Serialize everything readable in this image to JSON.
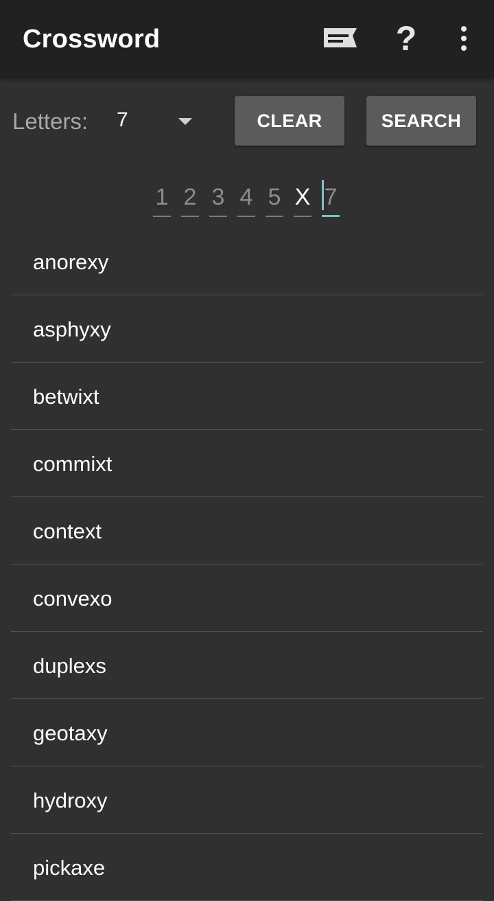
{
  "appbar": {
    "title": "Crossword",
    "actions": [
      {
        "icon": "feedback-icon"
      },
      {
        "icon": "help-icon",
        "glyph": "?"
      },
      {
        "icon": "more-vert-icon"
      }
    ]
  },
  "controls": {
    "letters_label": "Letters:",
    "letters_value": "7",
    "clear_label": "CLEAR",
    "search_label": "SEARCH"
  },
  "pattern": [
    {
      "char": "1",
      "filled": false
    },
    {
      "char": "2",
      "filled": false
    },
    {
      "char": "3",
      "filled": false
    },
    {
      "char": "4",
      "filled": false
    },
    {
      "char": "5",
      "filled": false
    },
    {
      "char": "X",
      "filled": true
    },
    {
      "char": "7",
      "filled": false,
      "active": true
    }
  ],
  "results": [
    "anorexy",
    "asphyxy",
    "betwixt",
    "commixt",
    "context",
    "convexo",
    "duplexs",
    "geotaxy",
    "hydroxy",
    "pickaxe"
  ],
  "colors": {
    "background": "#303030",
    "appbar": "#212121",
    "button": "#5b5b5b",
    "accent": "#7ec3c0"
  }
}
